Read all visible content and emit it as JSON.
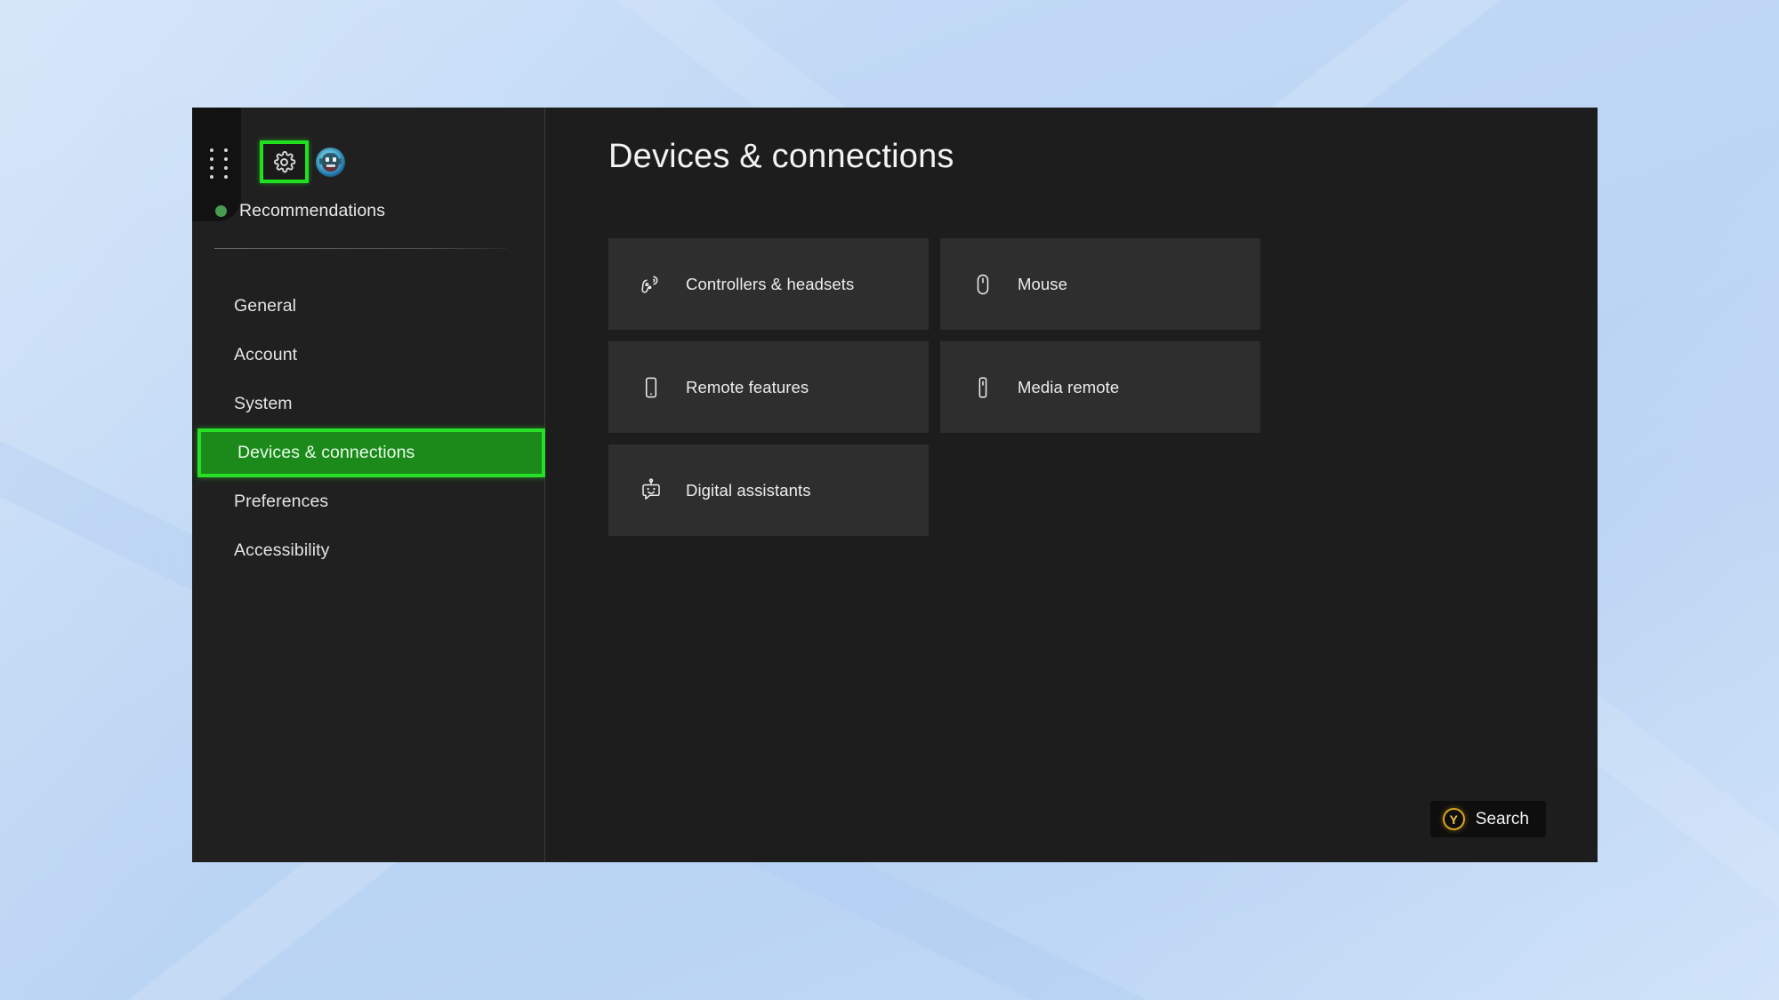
{
  "window": {
    "title": "Devices & connections"
  },
  "sidebar": {
    "handle_icon": "dots-grid-drag-handle-icon",
    "gear_icon": "gear-icon",
    "avatar_label": "avatar",
    "recommendations": {
      "label": "Recommendations",
      "badge_color": "#4a9b52"
    },
    "items": [
      {
        "label": "General",
        "selected": false
      },
      {
        "label": "Account",
        "selected": false
      },
      {
        "label": "System",
        "selected": false
      },
      {
        "label": "Devices & connections",
        "selected": true
      },
      {
        "label": "Preferences",
        "selected": false
      },
      {
        "label": "Accessibility",
        "selected": false
      }
    ]
  },
  "main": {
    "title": "Devices & connections",
    "tiles": [
      {
        "label": "Controllers & headsets",
        "icon": "game-controller-icon"
      },
      {
        "label": "Mouse",
        "icon": "mouse-icon"
      },
      {
        "label": "Remote features",
        "icon": "mobile-phone-icon"
      },
      {
        "label": "Media remote",
        "icon": "media-remote-icon"
      },
      {
        "label": "Digital assistants",
        "icon": "robot-assistant-icon"
      }
    ]
  },
  "footer": {
    "search": {
      "button_glyph": "Y",
      "label": "Search"
    }
  },
  "colors": {
    "highlight_green": "#26e026",
    "selection_fill": "#1b8a1b",
    "tile_bg": "#2e2e2e",
    "window_bg": "#1d1d1d",
    "sidebar_bg": "#202020",
    "y_button": "#d9a521",
    "desktop_bg": "#bdd6f4"
  }
}
